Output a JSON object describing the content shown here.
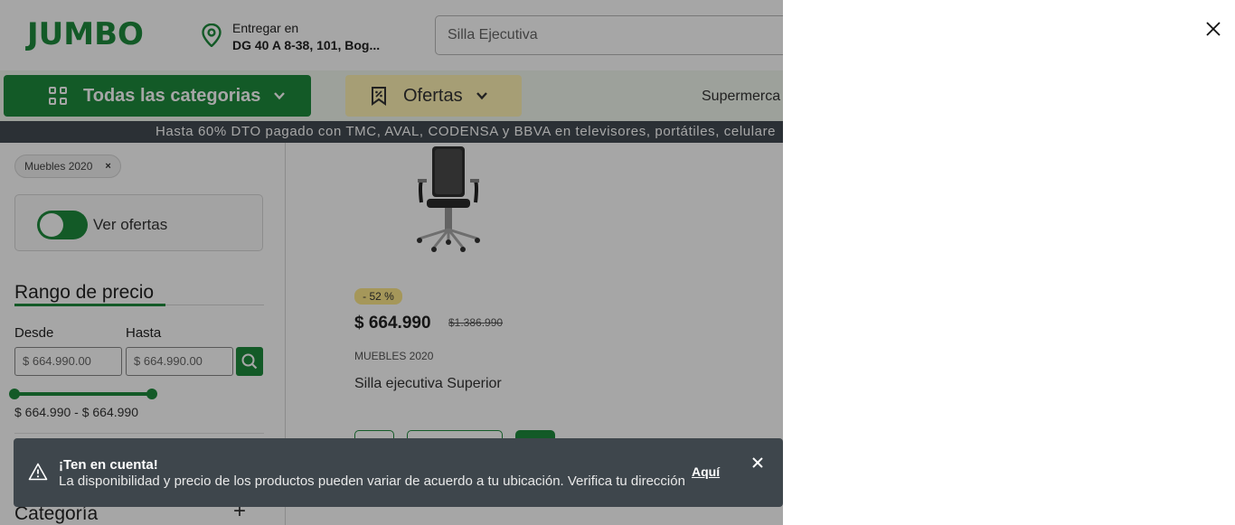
{
  "header": {
    "logo": "JUMBO",
    "location_label": "Entregar en",
    "location_address": "DG 40 A 8-38, 101, Bog...",
    "search_placeholder": "Silla Ejecutiva"
  },
  "nav": {
    "categories_label": "Todas las categorias",
    "offers_label": "Ofertas",
    "link_label": "Supermerca"
  },
  "banner": {
    "text": "Hasta 60% DTO pagado con TMC, AVAL, CODENSA y BBVA en televisores, portátiles, celulare"
  },
  "filters": {
    "chip_label": "Muebles 2020",
    "chip_remove": "×",
    "offers_toggle_label": "Ver ofertas",
    "offers_toggle_on": true,
    "price_title": "Rango de precio",
    "from_label": "Desde",
    "to_label": "Hasta",
    "from_value": "$ 664.990.00",
    "to_value": "$ 664.990.00",
    "range_text": "$ 664.990 - $ 664.990",
    "category_title": "Categoría",
    "category_expand": "+"
  },
  "product": {
    "discount": "- 52 %",
    "price": "$ 664.990",
    "old_price": "$1.386.990",
    "brand": "MUEBLES 2020",
    "name": "Silla ejecutiva Superior"
  },
  "toast": {
    "title": "¡Ten en cuenta!",
    "message": "La disponibilidad y precio de los productos pueden variar de acuerdo a tu ubicación. Verifica tu dirección",
    "link": "Aquí"
  },
  "colors": {
    "brand_green": "#1e8a3c",
    "offers_yellow": "#fff3b4",
    "banner_dark": "#424b52",
    "toast_dark": "#3e464c"
  }
}
